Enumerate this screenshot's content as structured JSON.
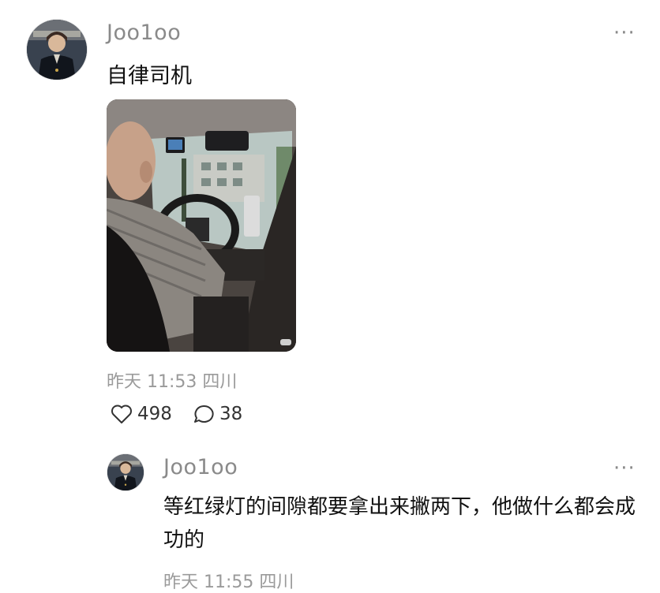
{
  "post": {
    "username": "Joo1oo",
    "text": "自律司机",
    "meta": "昨天 11:53 四川",
    "likes": "498",
    "comments": "38",
    "more": "···"
  },
  "reply": {
    "username": "Joo1oo",
    "text": "等红绿灯的间隙都要拿出来撇两下，他做什么都会成功的",
    "meta": "昨天 11:55 四川",
    "more": "···"
  },
  "icons": {
    "like": "heart-outline-icon",
    "comment": "speech-bubble-icon",
    "more": "more-dots-icon"
  },
  "colors": {
    "muted": "#8a8a8a",
    "text": "#111111"
  }
}
